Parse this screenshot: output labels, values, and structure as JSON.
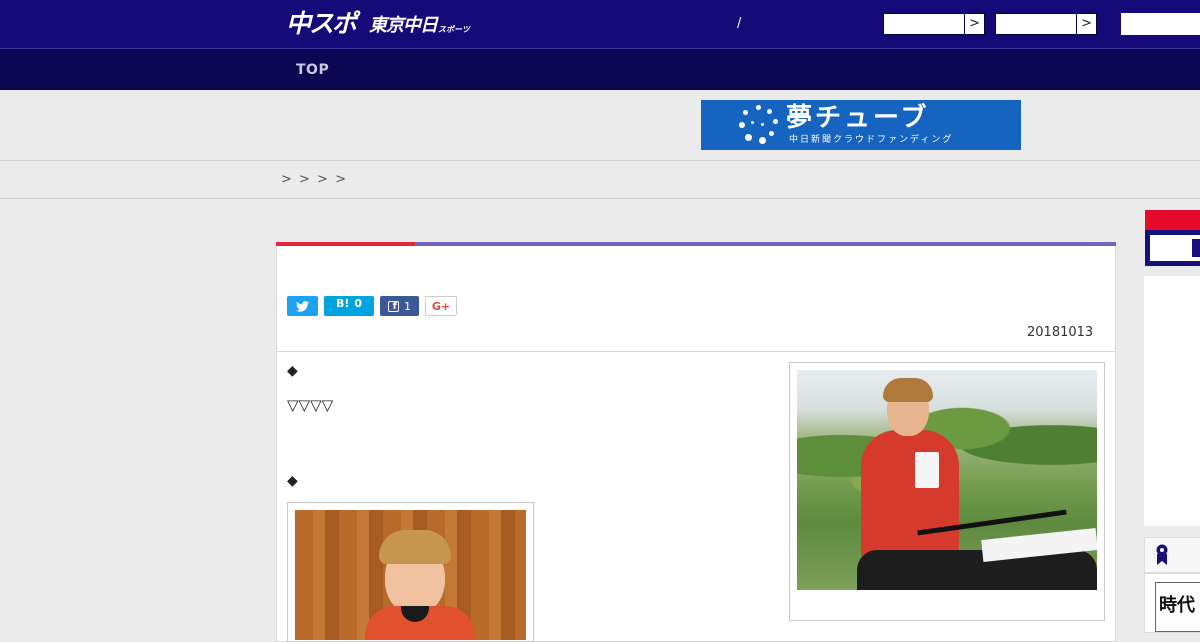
{
  "header": {
    "logo_main": "中スポ",
    "logo_sub": "東京中日",
    "logo_small": "スポーツ",
    "separator": "/",
    "menu_arrow": ">"
  },
  "nav": {
    "items": [
      {
        "label": "TOP"
      }
    ]
  },
  "banner": {
    "title": "夢チューブ",
    "subtitle": "中日新聞クラウドファンディング",
    "bg_color": "#1565c0"
  },
  "breadcrumb": {
    "text": "> > > >"
  },
  "share": {
    "hatena_label": "B!",
    "hatena_count": "0",
    "facebook_count": "1",
    "gplus_label": "G+",
    "twitter_color": "#1da1f2",
    "hatena_color": "#00a4de",
    "facebook_color": "#3b5998"
  },
  "article": {
    "date": "20181013",
    "line1": "◆",
    "line2": "▽▽▽▽",
    "line3": "◆"
  },
  "sidebar": {
    "thumb_text": "時代"
  },
  "colors": {
    "header_bg": "#150a78",
    "nav_bg": "#0c0653",
    "accent_red": "#e0263b",
    "accent_purple": "#7366b8"
  }
}
